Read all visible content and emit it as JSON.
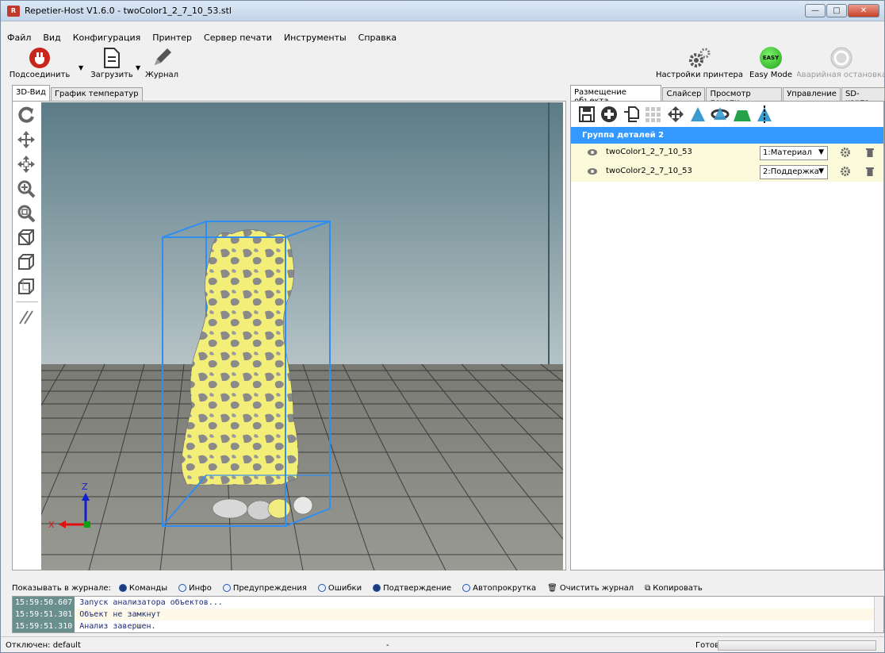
{
  "window": {
    "title": "Repetier-Host V1.6.0 - twoColor1_2_7_10_53.stl",
    "icon_label": "R"
  },
  "menu": [
    "Файл",
    "Вид",
    "Конфигурация",
    "Принтер",
    "Сервер печати",
    "Инструменты",
    "Справка"
  ],
  "toolbar": {
    "connect": "Подсоединить",
    "load": "Загрузить",
    "log": "Журнал",
    "printer_settings": "Настройки принтера",
    "easy_mode": "Easy Mode",
    "easy_badge": "EASY",
    "emergency_stop": "Аварийная остановка"
  },
  "left_tabs": [
    "3D-Вид",
    "График температур"
  ],
  "right_tabs": [
    "Размещение объекта",
    "Слайсер",
    "Просмотр печати",
    "Управление",
    "SD-карта"
  ],
  "object_group": {
    "title": "Группа деталей 2",
    "objects": [
      {
        "name": "twoColor1_2_7_10_53",
        "extruder": "1:Материал"
      },
      {
        "name": "twoColor2_2_7_10_53",
        "extruder": "2:Поддержка"
      }
    ]
  },
  "axes": {
    "x": "X",
    "z": "Z"
  },
  "log_filter": {
    "label": "Показывать в журнале:",
    "options": [
      {
        "label": "Команды",
        "checked": true
      },
      {
        "label": "Инфо",
        "checked": false
      },
      {
        "label": "Предупреждения",
        "checked": false
      },
      {
        "label": "Ошибки",
        "checked": false
      },
      {
        "label": "Подтверждение",
        "checked": true
      },
      {
        "label": "Автопрокрутка",
        "checked": false
      }
    ],
    "clear": "Очистить журнал",
    "copy": "Копировать"
  },
  "log_lines": [
    {
      "time": "15:59:50.607",
      "text": "Запуск анализатора объектов..."
    },
    {
      "time": "15:59:51.301",
      "text": "Объект не замкнут"
    },
    {
      "time": "15:59:51.310",
      "text": "Анализ завершен."
    }
  ],
  "status": {
    "connection": "Отключен: default",
    "middle": "-",
    "ready": "Готов"
  },
  "colors": {
    "accent": "#3399ff",
    "object_yellow": "#f2ee78",
    "object_gray": "#8a8a8a",
    "bbox": "#2f8ef0"
  }
}
